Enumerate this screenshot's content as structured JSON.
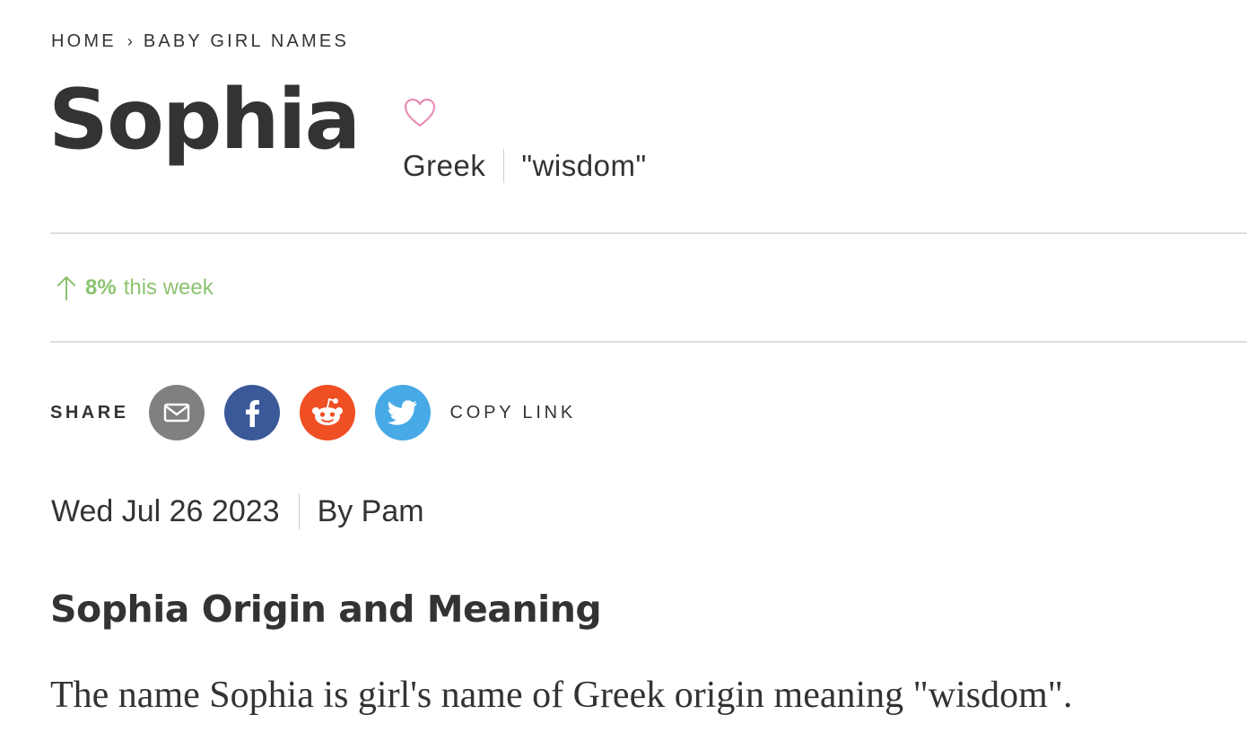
{
  "breadcrumb": {
    "home": "HOME",
    "separator": "›",
    "current": "BABY GIRL NAMES"
  },
  "name": {
    "title": "Sophia",
    "origin": "Greek",
    "meaning": "\"wisdom\""
  },
  "trend": {
    "percent": "8%",
    "label": "this week",
    "color": "#8cc36f"
  },
  "share": {
    "label": "SHARE",
    "buttons": [
      {
        "name": "email",
        "icon": "mail-icon",
        "color": "#808080"
      },
      {
        "name": "facebook",
        "icon": "facebook-icon",
        "color": "#3b5998"
      },
      {
        "name": "reddit",
        "icon": "reddit-icon",
        "color": "#f04e23"
      },
      {
        "name": "twitter",
        "icon": "twitter-icon",
        "color": "#47a9e6"
      }
    ],
    "copy_link": "COPY LINK"
  },
  "byline": {
    "date": "Wed Jul 26 2023",
    "author": "By Pam"
  },
  "section": {
    "heading": "Sophia Origin and Meaning",
    "body": "The name Sophia is girl's name of Greek origin meaning \"wisdom\"."
  },
  "favorite_icon_color": "#e58fb5"
}
